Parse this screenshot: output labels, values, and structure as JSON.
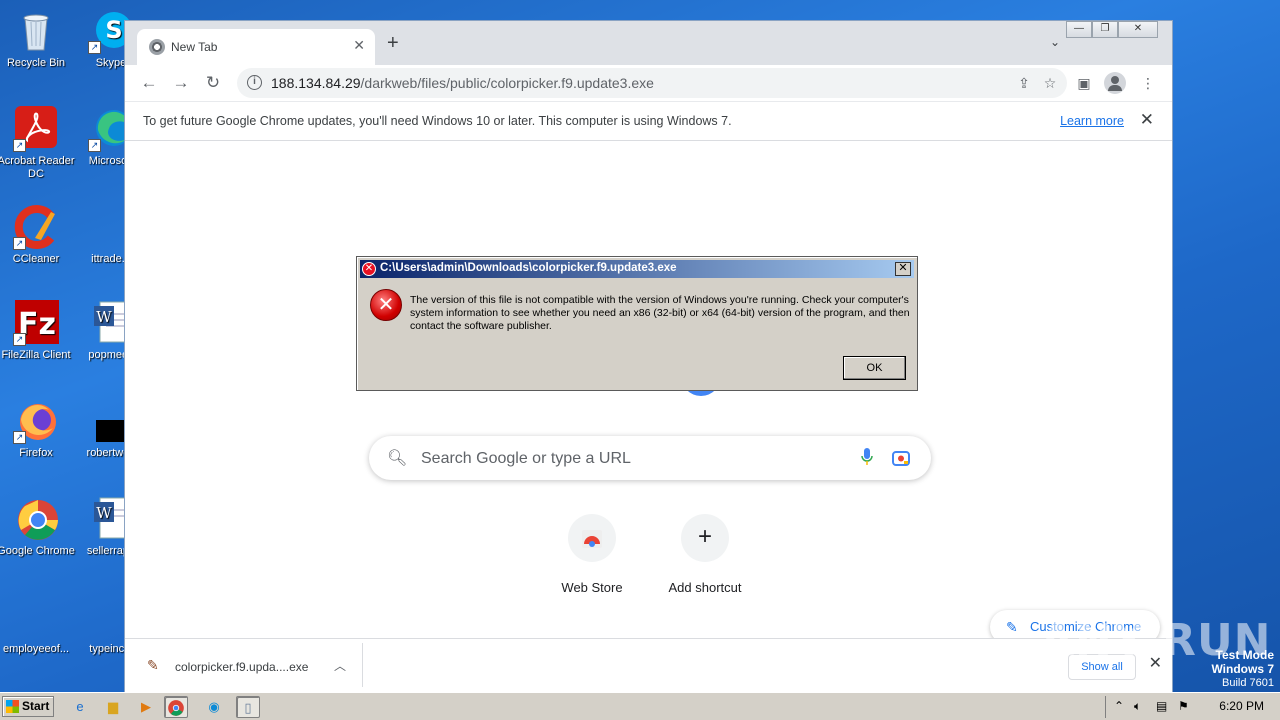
{
  "desktop": {
    "icons": [
      {
        "label": "Recycle Bin"
      },
      {
        "label": "Skype"
      },
      {
        "label": "Acrobat Reader DC"
      },
      {
        "label": "Microsoft"
      },
      {
        "label": "CCleaner"
      },
      {
        "label": "ittrade.p"
      },
      {
        "label": "FileZilla Client"
      },
      {
        "label": "popmeeti"
      },
      {
        "label": "Firefox"
      },
      {
        "label": "robertweb"
      },
      {
        "label": "Google Chrome"
      },
      {
        "label": "sellerrape"
      },
      {
        "label": "employeeof..."
      },
      {
        "label": "typeinclu"
      }
    ]
  },
  "browser": {
    "tab_title": "New Tab",
    "url_host": "188.134.84.29",
    "url_path": "/darkweb/files/public/colorpicker.f9.update3.exe",
    "infobar_message": "To get future Google Chrome updates, you'll need Windows 10 or later. This computer is using Windows 7.",
    "infobar_link": "Learn more",
    "search_placeholder": "Search Google or type a URL",
    "shortcuts": [
      {
        "label": "Web Store"
      },
      {
        "label": "Add shortcut"
      }
    ],
    "customize_label": "Customize Chrome",
    "download_filename": "colorpicker.f9.upda....exe",
    "show_all_label": "Show all"
  },
  "dialog": {
    "title": "C:\\Users\\admin\\Downloads\\colorpicker.f9.update3.exe",
    "message": "The version of this file is not compatible with the version of Windows you're running. Check your computer's system information to see whether you need an x86 (32-bit) or x64 (64-bit) version of the program, and then contact the software publisher.",
    "ok_label": "OK"
  },
  "taskbar": {
    "start_label": "Start",
    "clock": "6:20 PM"
  },
  "watermark": {
    "line1": "Test Mode",
    "line2": "Windows 7",
    "line3": "Build 7601",
    "brand": "ANY  RUN"
  },
  "colors": {
    "desktop_bg": "#1e68c8",
    "chrome_accent": "#1a73e8",
    "dialog_bg": "#d4d0c8",
    "dialog_title": "#0a246a"
  }
}
